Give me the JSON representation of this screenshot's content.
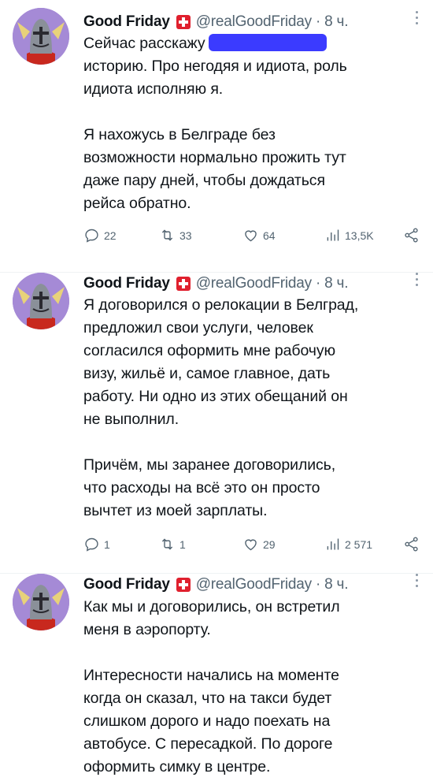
{
  "tweets": [
    {
      "author": "Good Friday",
      "handle": "@realGoodFriday",
      "dot": "·",
      "time": "8 ч.",
      "paragraphs": [
        "Сейчас расскажу",
        "историю. Про негодяя и идиота, роль\nидиота исполняю я.",
        "Я нахожусь в Белграде без\nвозможности нормально прожить тут\nдаже пару дней, чтобы дождаться\nрейса обратно."
      ],
      "stats": {
        "replies": "22",
        "retweets": "33",
        "likes": "64",
        "views": "13,5K"
      }
    },
    {
      "author": "Good Friday",
      "handle": "@realGoodFriday",
      "dot": "·",
      "time": "8 ч.",
      "paragraphs": [
        "Я договорился о релокации в Белград,\nпредложил свои услуги, человек\nсогласился оформить мне рабочую\nвизу, жильё и, самое главное, дать\nработу. Ни одно из этих обещаний он\nне выполнил.",
        "Причём, мы заранее договорились,\nчто расходы на всё это он просто\nвычтет из моей зарплаты."
      ],
      "stats": {
        "replies": "1",
        "retweets": "1",
        "likes": "29",
        "views": "2 571"
      }
    },
    {
      "author": "Good Friday",
      "handle": "@realGoodFriday",
      "dot": "·",
      "time": "8 ч.",
      "paragraphs": [
        "Как мы и договорились, он встретил\nменя в аэропорту.",
        "Интересности начались на моменте\nкогда он сказал, что на такси будет\nслишком дорого и надо поехать на\nавтобусе. С пересадкой. По дороге\nоформить симку в центре."
      ]
    }
  ]
}
